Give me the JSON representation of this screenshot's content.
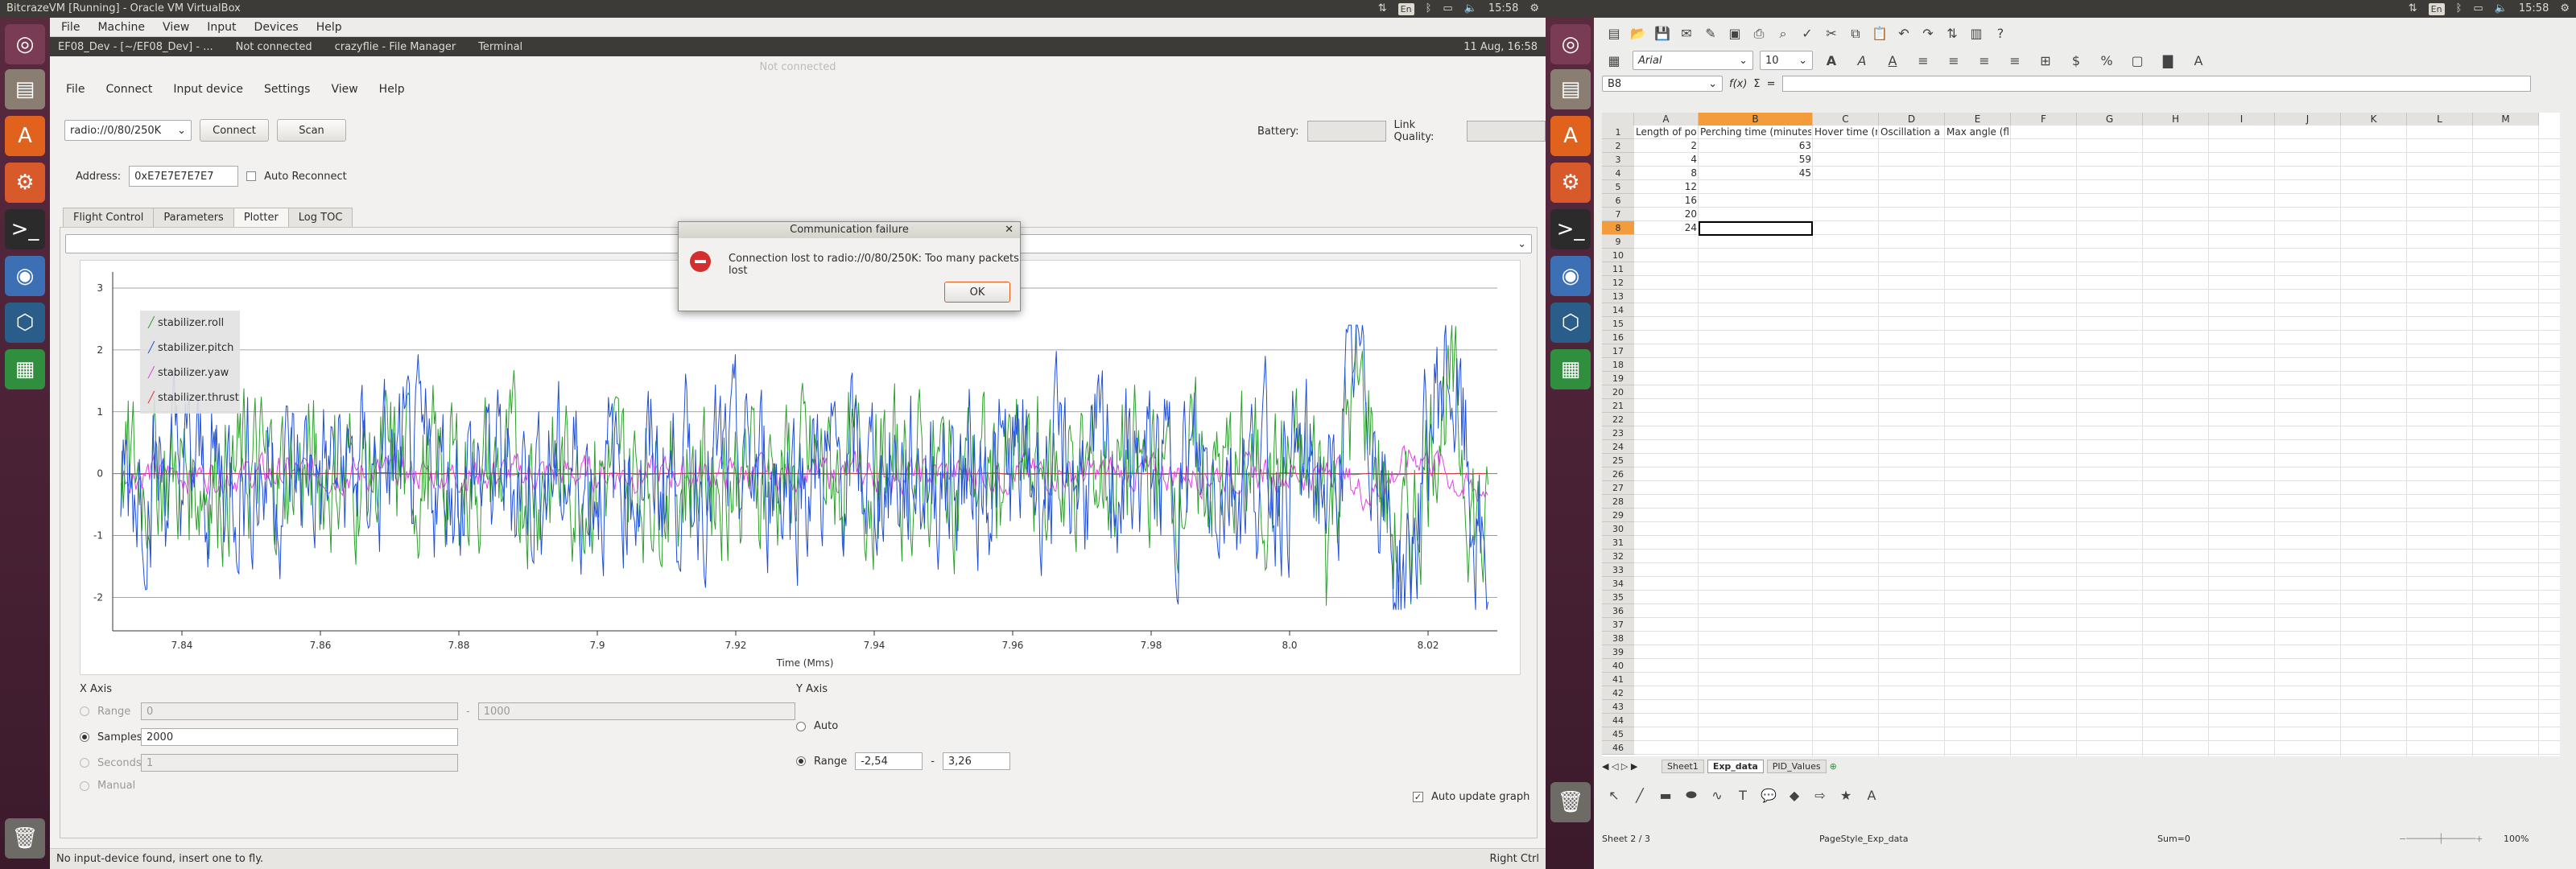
{
  "left_topbar": {
    "title": "BitcrazeVM [Running] - Oracle VM VirtualBox",
    "time": "15:58",
    "kbd": "En"
  },
  "right_topbar": {
    "time": "15:58",
    "kbd": "En"
  },
  "vbox_menu": [
    "File",
    "Machine",
    "View",
    "Input",
    "Devices",
    "Help"
  ],
  "guest_taskbar": {
    "items": [
      "EF08_Dev - [~/EF08_Dev] - ...",
      "Not connected",
      "crazyflie - File Manager",
      "Terminal"
    ],
    "clock": "11 Aug, 16:58"
  },
  "app": {
    "window_title": "Not connected",
    "menu": [
      "File",
      "Connect",
      "Input device",
      "Settings",
      "View",
      "Help"
    ],
    "radio_uri": "radio://0/80/250K",
    "connect_label": "Connect",
    "scan_label": "Scan",
    "battery_label": "Battery:",
    "link_quality_label": "Link Quality:",
    "address_label": "Address:",
    "address_value": "0xE7E7E7E7E7",
    "auto_reconnect_label": "Auto Reconnect",
    "tabs": [
      "Flight Control",
      "Parameters",
      "Plotter",
      "Log TOC"
    ],
    "active_tab": "Plotter",
    "legend": [
      {
        "name": "stabilizer.roll",
        "color": "#2ca02c"
      },
      {
        "name": "stabilizer.pitch",
        "color": "#1f4fd8"
      },
      {
        "name": "stabilizer.yaw",
        "color": "#e040e0"
      },
      {
        "name": "stabilizer.thrust",
        "color": "#e03030"
      }
    ],
    "xaxis_group": "X Axis",
    "yaxis_group": "Y Axis",
    "range_label": "Range",
    "range_from": "0",
    "range_to": "1000",
    "samples_label": "Samples",
    "samples_value": "2000",
    "seconds_label": "Seconds",
    "seconds_value": "1",
    "manual_label": "Manual",
    "auto_label": "Auto",
    "yrange_label": "Range",
    "yrange_min": "-2,54",
    "yrange_max": "3,26",
    "range_sep": "-",
    "auto_update_label": "Auto update graph",
    "status_text": "No input-device found, insert one to fly.",
    "right_ctrl": "Right Ctrl"
  },
  "chart_data": {
    "type": "line",
    "xlabel": "Time (Mms)",
    "x_ticks": [
      "7.84",
      "7.86",
      "7.88",
      "7.9",
      "7.92",
      "7.94",
      "7.96",
      "7.98",
      "8.0",
      "8.02"
    ],
    "y_ticks": [
      "3",
      "2",
      "1",
      "0",
      "-1",
      "-2"
    ],
    "xlim": [
      7.83,
      8.03
    ],
    "ylim": [
      -2.54,
      3.26
    ],
    "series": [
      {
        "name": "stabilizer.roll",
        "color": "#2ca02c"
      },
      {
        "name": "stabilizer.pitch",
        "color": "#1f4fd8"
      },
      {
        "name": "stabilizer.yaw",
        "color": "#e040e0"
      },
      {
        "name": "stabilizer.thrust",
        "color": "#e03030"
      }
    ]
  },
  "dialog": {
    "title": "Communication failure",
    "message": "Connection lost to radio://0/80/250K: Too many packets lost",
    "ok_label": "OK"
  },
  "calc": {
    "font_name": "Arial",
    "font_size": "10",
    "cell_ref": "B8",
    "columns": [
      "A",
      "B",
      "C",
      "D",
      "E",
      "F",
      "G",
      "H",
      "I",
      "J",
      "K",
      "L",
      "M"
    ],
    "rows": [
      "1",
      "2",
      "3",
      "4",
      "5",
      "6",
      "7",
      "8",
      "9",
      "10",
      "11",
      "12",
      "13",
      "14",
      "15",
      "16",
      "17",
      "18",
      "19",
      "20",
      "21",
      "22",
      "23",
      "24",
      "25",
      "26",
      "27",
      "28",
      "29",
      "30",
      "31",
      "32",
      "33",
      "34",
      "35",
      "36",
      "37",
      "38",
      "39",
      "40",
      "41",
      "42",
      "43",
      "44",
      "45",
      "46"
    ],
    "header": [
      "Length of pod",
      "Perching time (minutes)",
      "Hover time (m",
      "Oscillation a",
      "Max angle (flat aluminium plate)"
    ],
    "col_a": [
      "2",
      "4",
      "8",
      "12",
      "16",
      "20",
      "24"
    ],
    "col_b": [
      "63",
      "59",
      "45"
    ],
    "sheet_tabs": [
      "Sheet1",
      "Exp_data",
      "PID_Values"
    ],
    "status_sheet": "Sheet 2 / 3",
    "status_style": "PageStyle_Exp_data",
    "status_sum": "Sum=0",
    "zoom": "100%"
  }
}
